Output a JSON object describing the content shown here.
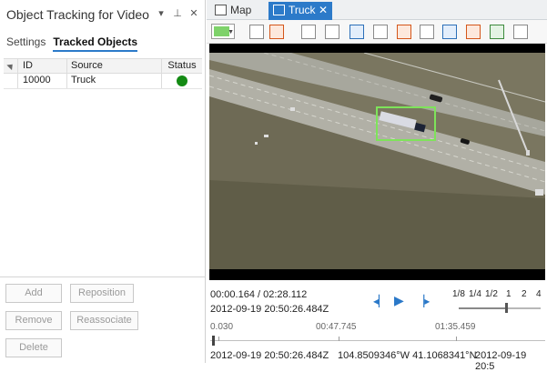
{
  "pane": {
    "title": "Object Tracking for Video",
    "subtabs": [
      "Settings",
      "Tracked Objects"
    ],
    "columns": [
      "ID",
      "Source",
      "Status"
    ],
    "rows": [
      {
        "id": "10000",
        "source": "Truck",
        "status_color": "#138a13"
      }
    ],
    "buttons": {
      "add": "Add",
      "reposition": "Reposition",
      "remove": "Remove",
      "reassociate": "Reassociate",
      "delete": "Delete"
    }
  },
  "tabs": [
    {
      "label": "Map"
    },
    {
      "label": "Truck",
      "active": true
    }
  ],
  "toolbar": {
    "color": "#7ed26a",
    "tools": [
      "bookmark-icon",
      "ruler-icon",
      "zoom-to-icon",
      "pan-icon",
      "north-arrow-icon",
      "link-icon",
      "capture-frame-icon",
      "export-icon",
      "add-layer-icon",
      "clip-icon",
      "image-icon",
      "sync-icon"
    ]
  },
  "video": {
    "tracked_object": "Truck",
    "box_color": "#7ee35a"
  },
  "playback": {
    "current": "00:00.164 / 02:28.112",
    "timestamp": "2012-09-19 20:50:26.484Z",
    "speeds": [
      "1/8",
      "1/4",
      "1/2",
      "1",
      "2",
      "4"
    ],
    "speed_selected": "2",
    "timeline_labels": [
      "0.030",
      "00:47.745",
      "01:35.459"
    ],
    "timeline_progress": 0.001,
    "bottom_left": "2012-09-19 20:50:26.484Z",
    "coords": "104.8509346°W 41.1068341°N",
    "bottom_right": "2012-09-19 20:5"
  }
}
